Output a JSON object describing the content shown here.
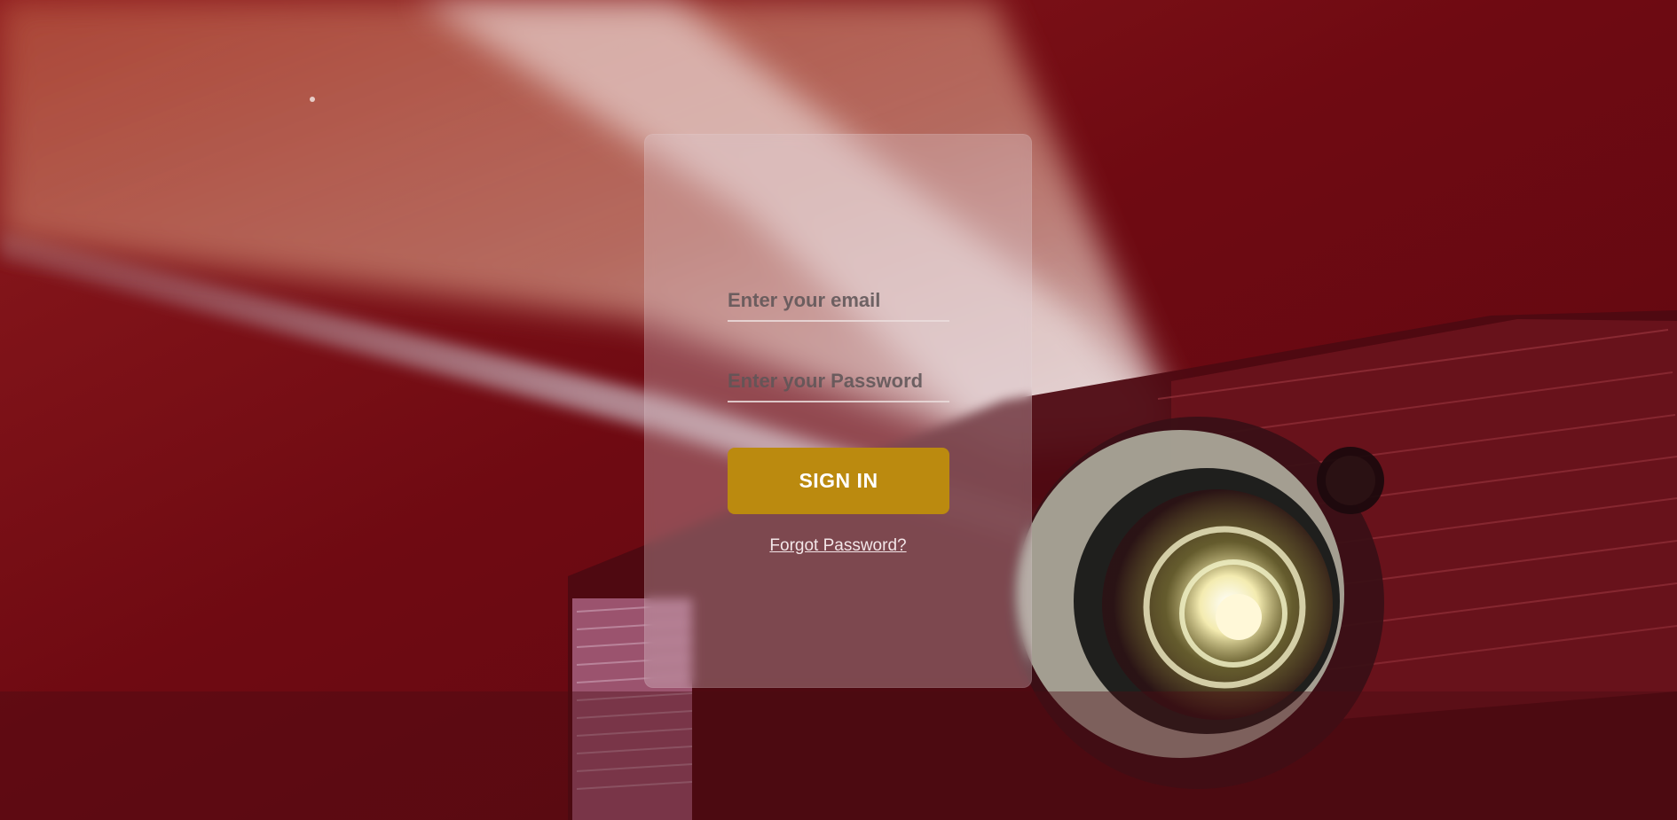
{
  "background": {
    "description_icon": "projector-background",
    "colors": {
      "base": "#7a0d14",
      "beam": "#d8a48e",
      "glow": "#ffffff"
    }
  },
  "login": {
    "email_placeholder": "Enter your email",
    "email_value": "",
    "password_placeholder": "Enter your Password",
    "password_value": "",
    "sign_in_label": "SIGN IN",
    "forgot_password_label": "Forgot Password?"
  },
  "theme": {
    "accent": "#bb8a0f",
    "card": "rgba(225,205,210,0.32)"
  }
}
